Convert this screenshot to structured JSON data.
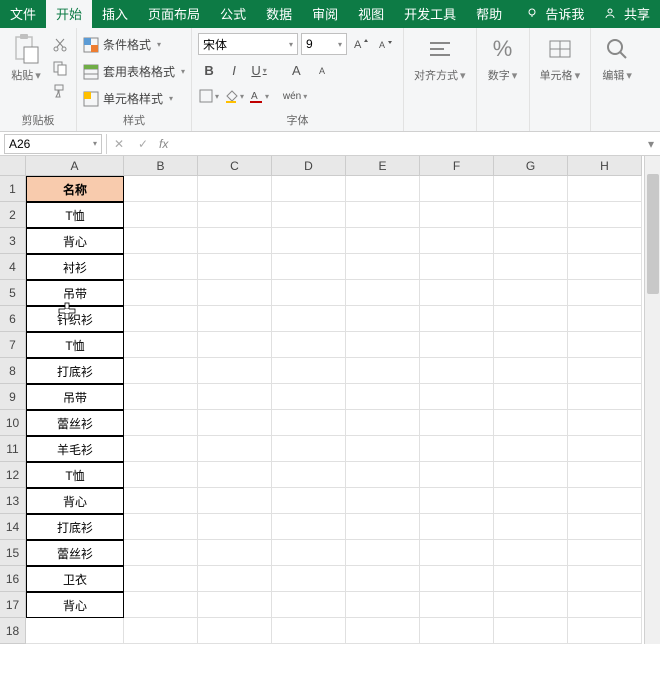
{
  "tabs": {
    "file": "文件",
    "home": "开始",
    "insert": "插入",
    "layout": "页面布局",
    "formulas": "公式",
    "data": "数据",
    "review": "审阅",
    "view": "视图",
    "dev": "开发工具",
    "help": "帮助",
    "tellme": "告诉我",
    "share": "共享"
  },
  "ribbon": {
    "clipboard": {
      "label": "剪贴板",
      "paste": "粘贴"
    },
    "styles": {
      "label": "样式",
      "cond": "条件格式",
      "table": "套用表格格式",
      "cell": "单元格样式"
    },
    "font": {
      "label": "字体",
      "name": "宋体",
      "size": "9",
      "bold": "B",
      "italic": "I",
      "underline": "U",
      "wen": "wén"
    },
    "align": {
      "label": "对齐方式"
    },
    "number": {
      "label": "数字",
      "symbol": "%"
    },
    "cells": {
      "label": "单元格"
    },
    "edit": {
      "label": "编辑"
    }
  },
  "namebox": "A26",
  "fx": "fx",
  "columns": [
    "A",
    "B",
    "C",
    "D",
    "E",
    "F",
    "G",
    "H"
  ],
  "header_cell": "名称",
  "rows": [
    "T恤",
    "背心",
    "衬衫",
    "吊带",
    "针织衫",
    "T恤",
    "打底衫",
    "吊带",
    "蕾丝衫",
    "羊毛衫",
    "T恤",
    "背心",
    "打底衫",
    "蕾丝衫",
    "卫衣",
    "背心"
  ]
}
